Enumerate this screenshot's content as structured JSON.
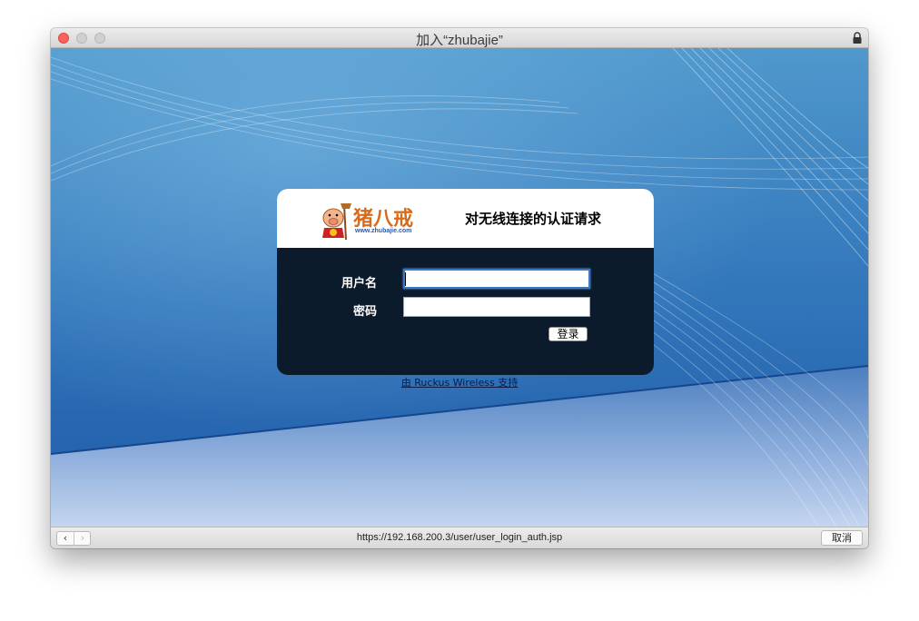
{
  "window": {
    "title": "加入“zhubajie”"
  },
  "logo": {
    "brand_text": "猪八戒",
    "url_text": "www.zhubajie.com"
  },
  "auth": {
    "title": "对无线连接的认证请求",
    "username_label": "用户名",
    "username_value": "",
    "password_label": "密码",
    "password_value": "",
    "login_label": "登录"
  },
  "footer": {
    "powered_by": "由 Ruckus Wireless 支持"
  },
  "bottom_bar": {
    "back_label": "‹",
    "forward_label": "›",
    "url": "https://192.168.200.3/user/user_login_auth.jsp",
    "cancel_label": "取消"
  },
  "colors": {
    "panel_dark": "#0b1b2c",
    "background_blue": "#2f6db3",
    "close_red": "#fc605c"
  }
}
